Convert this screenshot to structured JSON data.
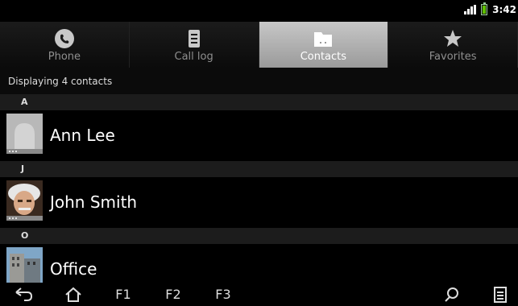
{
  "status": {
    "time": "3:42"
  },
  "tabs": [
    {
      "label": "Phone",
      "icon": "phone-icon",
      "selected": false
    },
    {
      "label": "Call log",
      "icon": "call-log-icon",
      "selected": false
    },
    {
      "label": "Contacts",
      "icon": "contacts-icon",
      "selected": true
    },
    {
      "label": "Favorites",
      "icon": "star-icon",
      "selected": false
    }
  ],
  "summary": "Displaying 4 contacts",
  "sections": [
    {
      "letter": "A",
      "contacts": [
        {
          "name": "Ann Lee",
          "avatar": "default-avatar"
        }
      ]
    },
    {
      "letter": "J",
      "contacts": [
        {
          "name": "John Smith",
          "avatar": "photo-avatar"
        }
      ]
    },
    {
      "letter": "O",
      "contacts": [
        {
          "name": "Office",
          "avatar": "building-photo"
        }
      ]
    }
  ],
  "navbar": {
    "back_icon": "back-icon",
    "home_icon": "home-icon",
    "f1": "F1",
    "f2": "F2",
    "f3": "F3",
    "search_icon": "search-icon",
    "menu_icon": "menu-icon"
  },
  "colors": {
    "selected_tab": "#b0b0b0",
    "section_header": "#1c1c1c",
    "battery": "#5ec000"
  }
}
